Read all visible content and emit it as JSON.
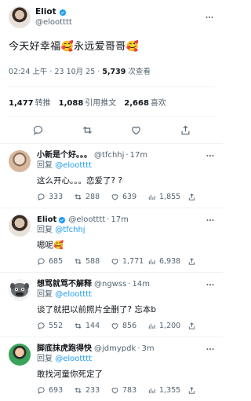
{
  "main": {
    "display_name": "Eliot",
    "handle": "@elootttt",
    "text": "今天好幸福🥰永远爱哥哥🥰",
    "time": "02:24 上午 · 23 10月 25 · ",
    "views_count": "5,739",
    "views_label": " 次查看",
    "stats": [
      {
        "count": "1,477",
        "label": "转推"
      },
      {
        "count": "1,088",
        "label": "引用推文"
      },
      {
        "count": "2,668",
        "label": "喜欢"
      }
    ]
  },
  "replies": [
    {
      "name": "小新是个好。。。",
      "handle": "@tfchhj",
      "time": "17m",
      "replying_prefix": "回复 ",
      "replying_to": "@elootttt",
      "text": "这么开心。。。恋爱了? ?",
      "replies": "333",
      "retweets": "288",
      "likes": "639",
      "views": "1,855"
    },
    {
      "name": "Eliot",
      "handle": "@elootttt",
      "time": "17m",
      "replying_prefix": "回复 ",
      "replying_to": "@tfchhj",
      "text": "嗯呢🥰",
      "replies": "685",
      "retweets": "588",
      "likes": "1,771",
      "views": "6,938"
    },
    {
      "name": "想骂就骂不解释",
      "handle": "@ngwss",
      "time": "14m",
      "replying_prefix": "回复 ",
      "replying_to": "@elootttt",
      "text": "谈了就把以前照片全删了? 忘本b",
      "replies": "552",
      "retweets": "144",
      "likes": "856",
      "views": "1,200"
    },
    {
      "name": "脚底抹虎跑得快",
      "handle": "@jdmypdk",
      "time": "3m",
      "replying_prefix": "回复 ",
      "replying_to": "@elootttt",
      "text": "敢找河童你死定了",
      "replies": "693",
      "retweets": "233",
      "likes": "783",
      "views": "1,355"
    }
  ],
  "colors": {
    "accent": "#1d9bf0",
    "muted": "#536471",
    "text": "#0f1419",
    "divider": "#eff3f4"
  },
  "icons": [
    "verified-icon",
    "more-icon",
    "reply-icon",
    "retweet-icon",
    "like-icon",
    "share-icon",
    "views-icon"
  ]
}
